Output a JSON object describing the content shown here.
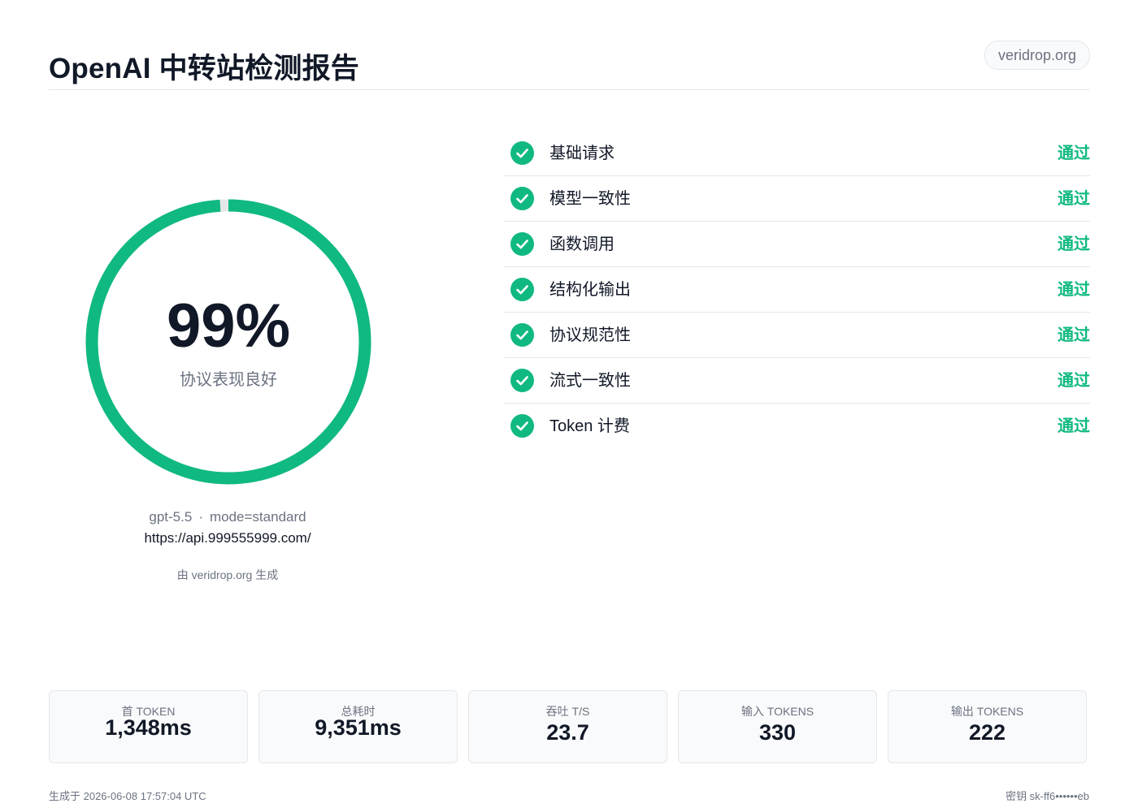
{
  "header": {
    "title": "OpenAI 中转站检测报告",
    "site_badge": "veridrop.org"
  },
  "summary": {
    "score": "99%",
    "score_value": 99,
    "score_label": "协议表现良好",
    "model": "gpt-5.5",
    "separator": "·",
    "mode": "mode=standard",
    "endpoint_url": "https://api.999555999.com/",
    "generated_by": "由 veridrop.org 生成"
  },
  "checks": [
    {
      "name": "基础请求",
      "status": "通过"
    },
    {
      "name": "模型一致性",
      "status": "通过"
    },
    {
      "name": "函数调用",
      "status": "通过"
    },
    {
      "name": "结构化输出",
      "status": "通过"
    },
    {
      "name": "协议规范性",
      "status": "通过"
    },
    {
      "name": "流式一致性",
      "status": "通过"
    },
    {
      "name": "Token 计费",
      "status": "通过"
    }
  ],
  "stats": [
    {
      "label": "首 TOKEN",
      "value": "1,348ms"
    },
    {
      "label": "总耗时",
      "value": "9,351ms"
    },
    {
      "label": "吞吐 T/S",
      "value": "23.7"
    },
    {
      "label": "输入 TOKENS",
      "value": "330"
    },
    {
      "label": "输出 TOKENS",
      "value": "222"
    }
  ],
  "footer": {
    "generated_at": "生成于 2026-06-08 17:57:04 UTC",
    "api_key": "密钥 sk-ff6••••••eb"
  },
  "colors": {
    "accent": "#10b981",
    "text": "#111827",
    "muted": "#6b7280",
    "border": "#e5e7eb"
  },
  "icons": {
    "check": "check-circle-icon"
  }
}
